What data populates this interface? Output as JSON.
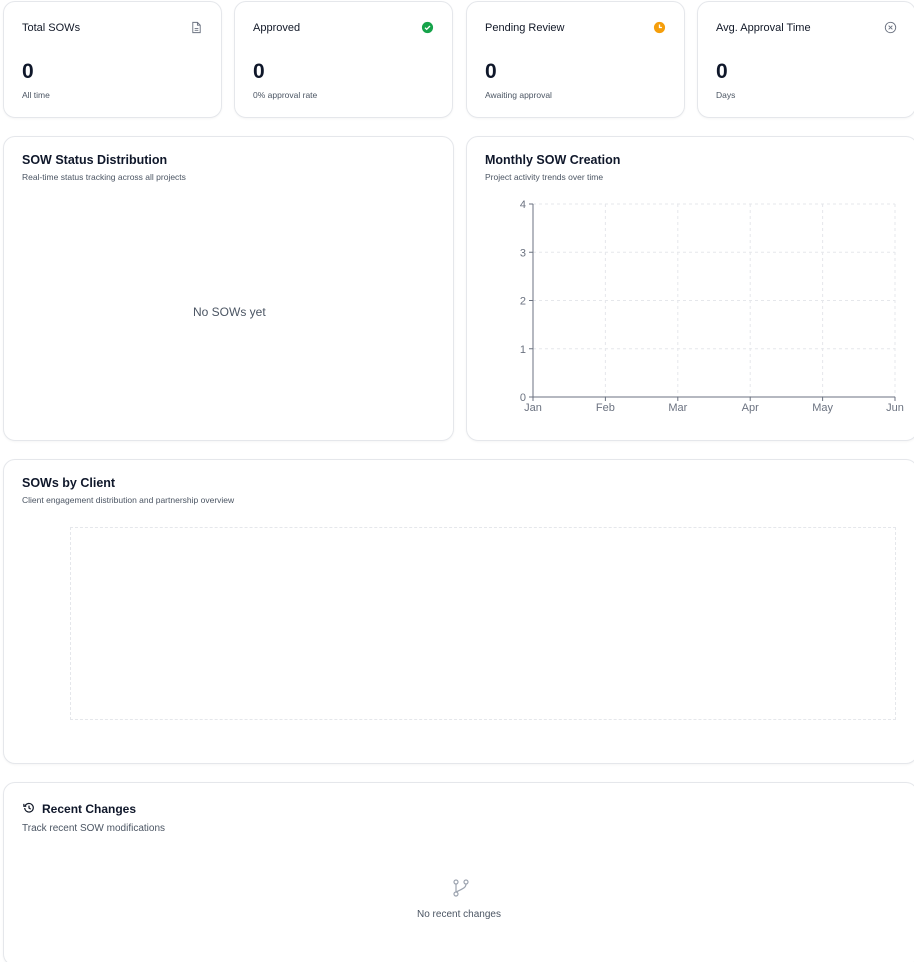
{
  "stats": [
    {
      "label": "Total SOWs",
      "value": "0",
      "sub": "All time",
      "icon": "file-icon",
      "icon_color": "#6b7280"
    },
    {
      "label": "Approved",
      "value": "0",
      "sub": "0% approval rate",
      "icon": "check-circle-icon",
      "icon_color": "#16a34a"
    },
    {
      "label": "Pending Review",
      "value": "0",
      "sub": "Awaiting approval",
      "icon": "clock-icon",
      "icon_color": "#f59e0b"
    },
    {
      "label": "Avg. Approval Time",
      "value": "0",
      "sub": "Days",
      "icon": "x-circle-icon",
      "icon_color": "#6b7280"
    }
  ],
  "status_distribution": {
    "title": "SOW Status Distribution",
    "subtitle": "Real-time status tracking across all projects",
    "empty": "No SOWs yet"
  },
  "monthly": {
    "title": "Monthly SOW Creation",
    "subtitle": "Project activity trends over time"
  },
  "by_client": {
    "title": "SOWs by Client",
    "subtitle": "Client engagement distribution and partnership overview"
  },
  "recent": {
    "title": "Recent Changes",
    "subtitle": "Track recent SOW modifications",
    "empty": "No recent changes",
    "icon": "history-icon",
    "empty_icon": "git-branch-icon"
  },
  "chart_data": {
    "type": "line",
    "categories": [
      "Jan",
      "Feb",
      "Mar",
      "Apr",
      "May",
      "Jun"
    ],
    "series": [],
    "ylim": [
      0,
      4
    ],
    "yticks": [
      "0",
      "1",
      "2",
      "3",
      "4"
    ],
    "grid": true
  }
}
